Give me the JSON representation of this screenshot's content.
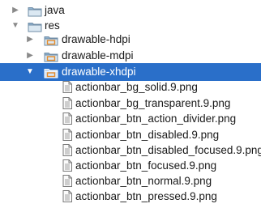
{
  "tree": {
    "nodes": [
      {
        "label": "java",
        "kind": "folder",
        "state": "collapsed",
        "depth": 0,
        "selected": false,
        "icon": "folder-icon"
      },
      {
        "label": "res",
        "kind": "folder",
        "state": "expanded",
        "depth": 0,
        "selected": false,
        "icon": "folder-icon"
      },
      {
        "label": "drawable-hdpi",
        "kind": "res-folder",
        "state": "collapsed",
        "depth": 1,
        "selected": false,
        "icon": "resource-folder-icon"
      },
      {
        "label": "drawable-mdpi",
        "kind": "res-folder",
        "state": "collapsed",
        "depth": 1,
        "selected": false,
        "icon": "resource-folder-icon"
      },
      {
        "label": "drawable-xhdpi",
        "kind": "res-folder",
        "state": "expanded",
        "depth": 1,
        "selected": true,
        "icon": "resource-folder-icon"
      },
      {
        "label": "actionbar_bg_solid.9.png",
        "kind": "file",
        "depth": 2,
        "selected": false,
        "icon": "image-file-icon"
      },
      {
        "label": "actionbar_bg_transparent.9.png",
        "kind": "file",
        "depth": 2,
        "selected": false,
        "icon": "image-file-icon"
      },
      {
        "label": "actionbar_btn_action_divider.png",
        "kind": "file",
        "depth": 2,
        "selected": false,
        "icon": "image-file-icon"
      },
      {
        "label": "actionbar_btn_disabled.9.png",
        "kind": "file",
        "depth": 2,
        "selected": false,
        "icon": "image-file-icon"
      },
      {
        "label": "actionbar_btn_disabled_focused.9.png",
        "kind": "file",
        "depth": 2,
        "selected": false,
        "icon": "image-file-icon"
      },
      {
        "label": "actionbar_btn_focused.9.png",
        "kind": "file",
        "depth": 2,
        "selected": false,
        "icon": "image-file-icon"
      },
      {
        "label": "actionbar_btn_normal.9.png",
        "kind": "file",
        "depth": 2,
        "selected": false,
        "icon": "image-file-icon"
      },
      {
        "label": "actionbar_btn_pressed.9.png",
        "kind": "file",
        "depth": 2,
        "selected": false,
        "icon": "image-file-icon"
      }
    ]
  },
  "colors": {
    "selection": "#2a6fc9",
    "folder": "#8fb2cf",
    "res_folder_accent": "#e38b2c",
    "text": "#1a1a1a"
  }
}
